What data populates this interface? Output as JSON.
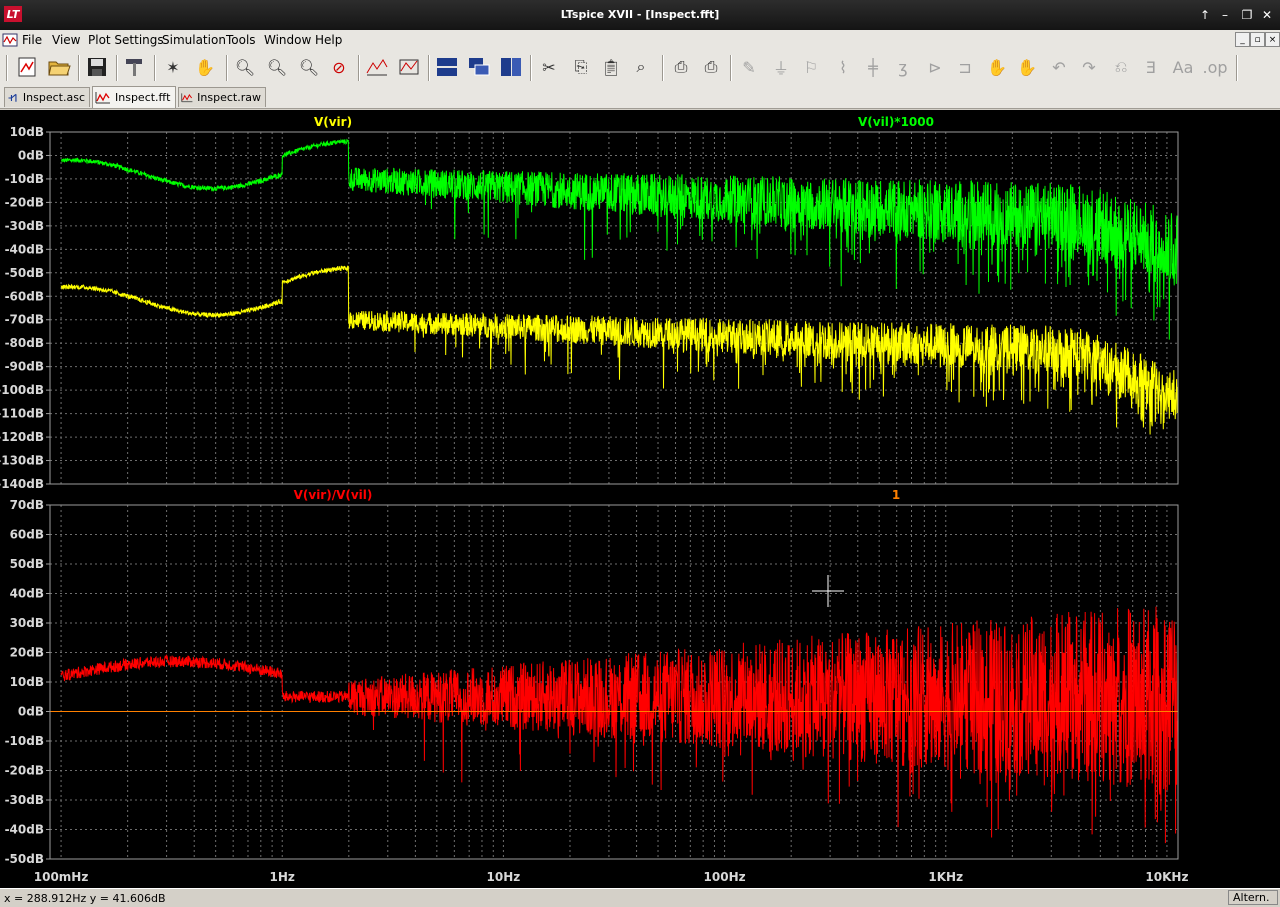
{
  "window": {
    "title": "LTspice XVII - [Inspect.fft]",
    "app_icon": "LT"
  },
  "menu": [
    "File",
    "View",
    "Plot Settings",
    "Simulation",
    "Tools",
    "Window",
    "Help"
  ],
  "tabs": [
    {
      "label": "Inspect.asc",
      "icon": "schematic-icon",
      "active": false
    },
    {
      "label": "Inspect.fft",
      "icon": "waveform-icon",
      "active": true
    },
    {
      "label": "Inspect.raw",
      "icon": "waveform-icon",
      "active": false
    }
  ],
  "plots": {
    "top": {
      "traces": [
        {
          "name": "V(vir)",
          "color": "#ffff00"
        },
        {
          "name": "V(vil)*1000",
          "color": "#00ff00"
        }
      ],
      "y_ticks": [
        "10dB",
        "0dB",
        "-10dB",
        "-20dB",
        "-30dB",
        "-40dB",
        "-50dB",
        "-60dB",
        "-70dB",
        "-80dB",
        "-90dB",
        "-100dB",
        "-110dB",
        "-120dB",
        "-130dB",
        "-140dB"
      ],
      "y_range": [
        -140,
        10
      ]
    },
    "bottom": {
      "traces": [
        {
          "name": "V(vir)/V(vil)",
          "color": "#ff0000"
        },
        {
          "name": "1",
          "color": "#ff8000"
        }
      ],
      "y_ticks": [
        "70dB",
        "60dB",
        "50dB",
        "40dB",
        "30dB",
        "20dB",
        "10dB",
        "0dB",
        "-10dB",
        "-20dB",
        "-30dB",
        "-40dB",
        "-50dB"
      ],
      "y_range": [
        -50,
        70
      ]
    },
    "x_ticks": [
      "100mHz",
      "1Hz",
      "10Hz",
      "100Hz",
      "1KHz",
      "10KHz"
    ],
    "x_range": [
      "100mHz",
      "10KHz"
    ],
    "x_scale": "log"
  },
  "status": {
    "coordinates": "x = 288.912Hz    y = 41.606dB",
    "mode": "Altern."
  }
}
